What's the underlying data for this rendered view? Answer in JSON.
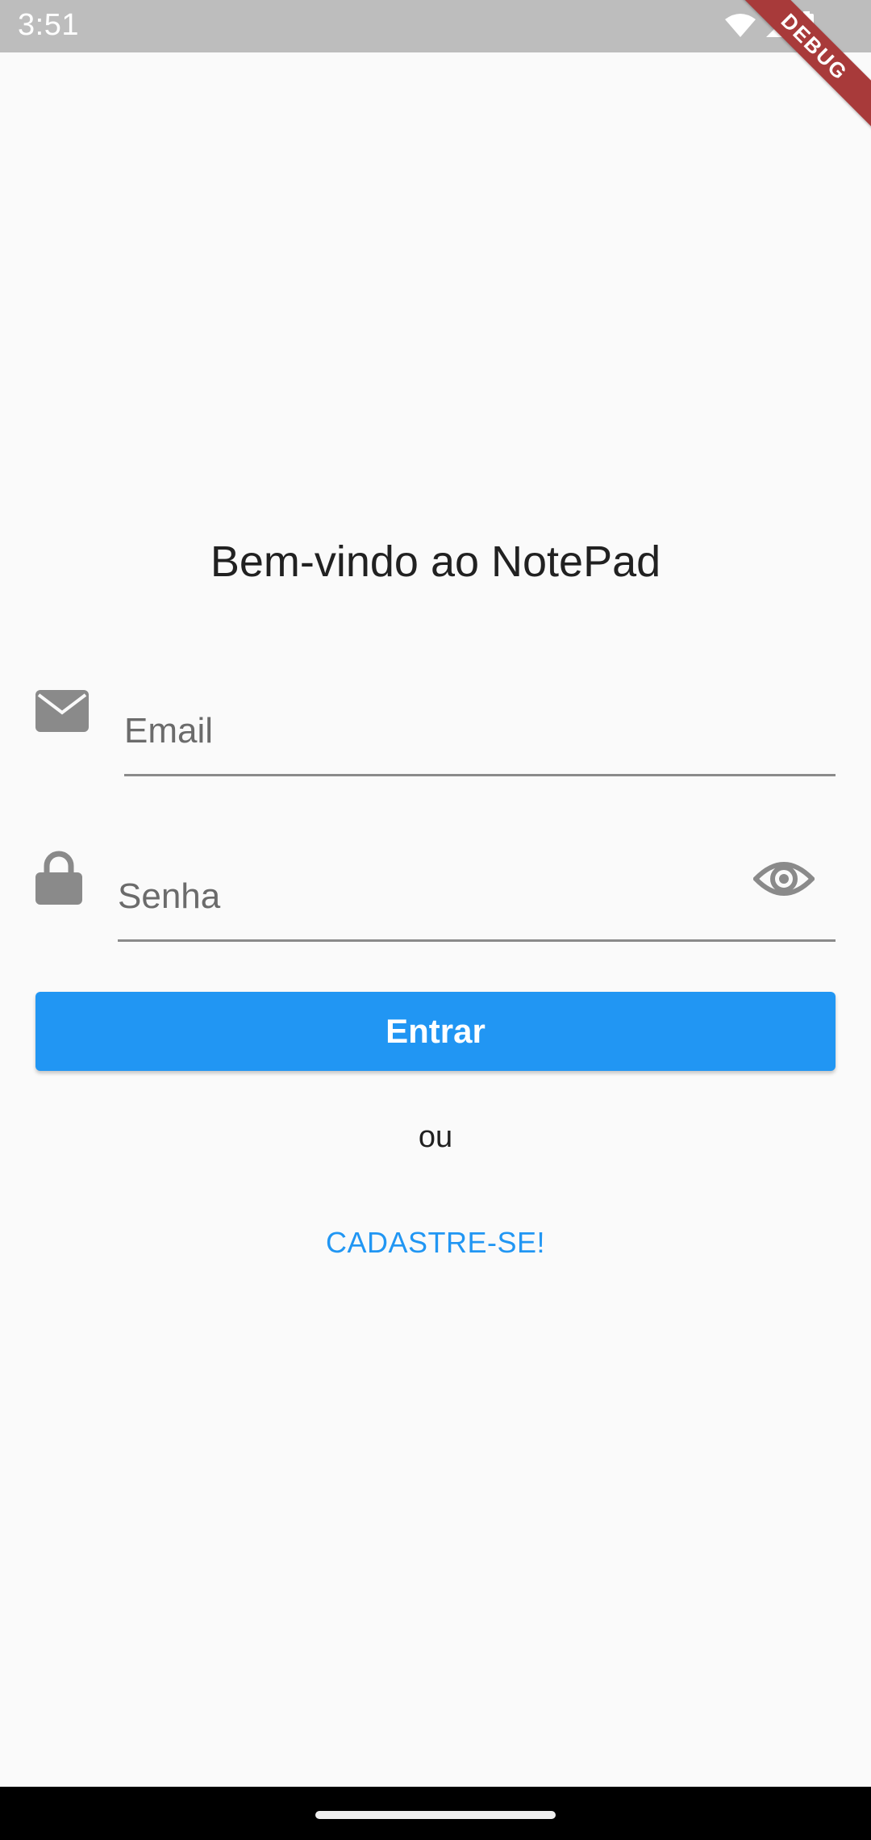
{
  "status_bar": {
    "time": "3:51",
    "icons": [
      "wifi-icon",
      "cellular-signal-icon",
      "battery-icon"
    ]
  },
  "debug_banner": {
    "label": "DEBUG"
  },
  "login": {
    "title": "Bem-vindo ao NotePad",
    "email": {
      "icon": "envelope-icon",
      "placeholder": "Email",
      "value": ""
    },
    "password": {
      "icon": "lock-icon",
      "placeholder": "Senha",
      "value": "",
      "toggle_icon": "eye-icon"
    },
    "submit_label": "Entrar",
    "separator_text": "ou",
    "signup_label": "CADASTRE-SE!"
  },
  "colors": {
    "primary": "#2196f3",
    "background": "#fafafa",
    "icon_gray": "#8a8a8a",
    "status_bar": "#bdbdbd",
    "debug_banner": "#a83a3a"
  }
}
